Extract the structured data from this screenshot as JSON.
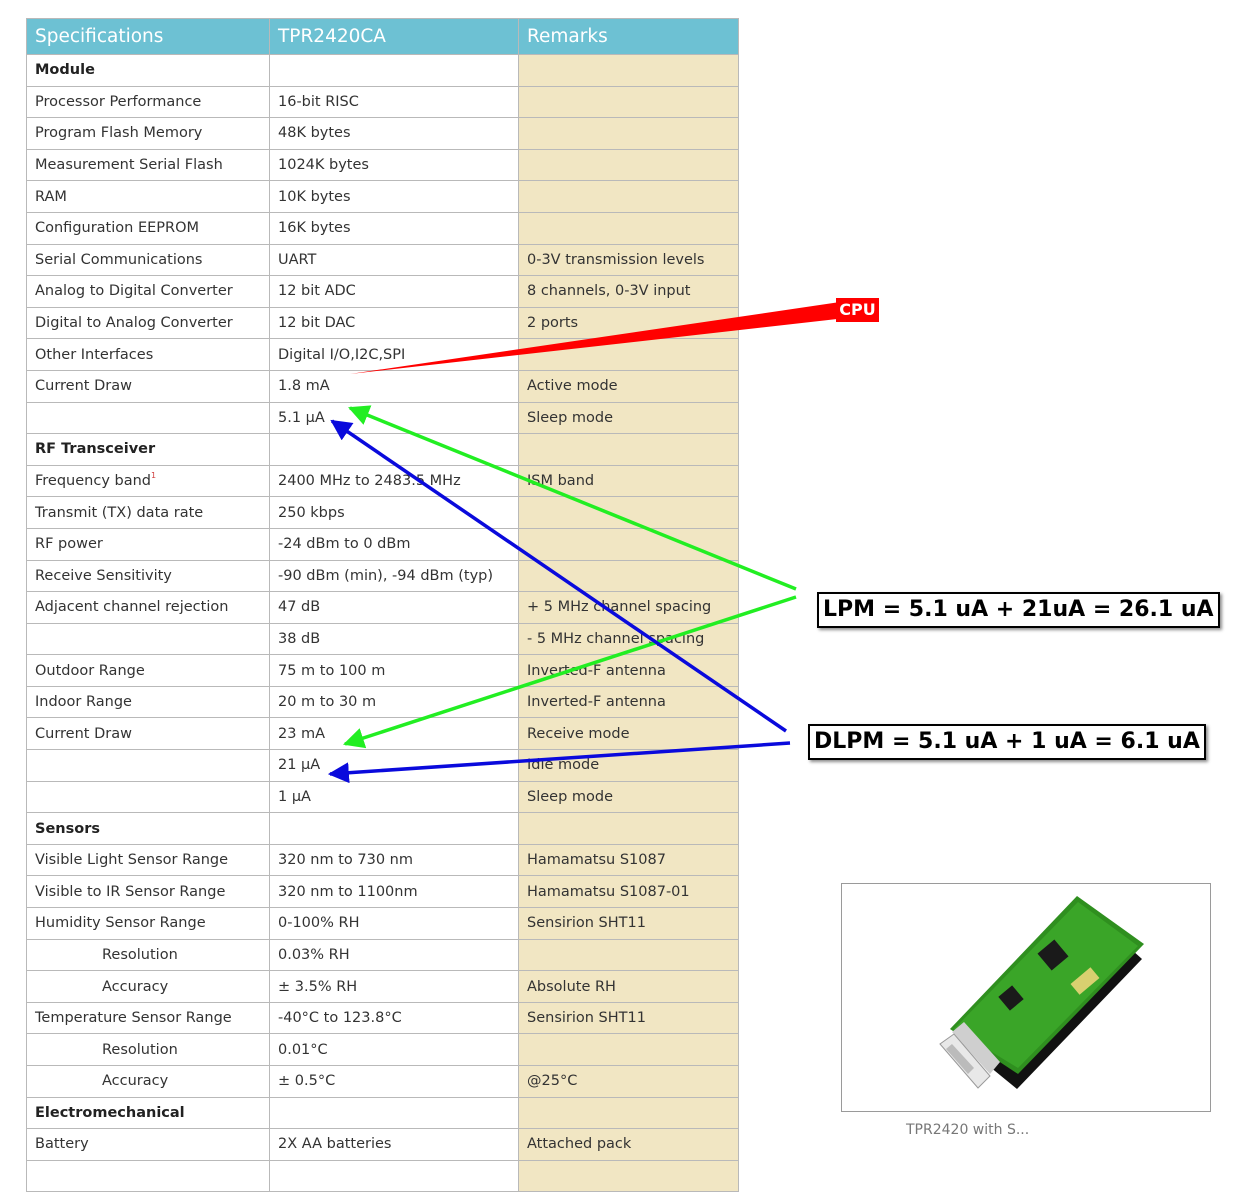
{
  "table": {
    "headers": [
      "Specifications",
      "TPR2420CA",
      "Remarks"
    ],
    "rows": [
      {
        "type": "section",
        "spec": "Module",
        "value": "",
        "remark": ""
      },
      {
        "spec": "Processor Performance",
        "value": "16-bit RISC",
        "remark": ""
      },
      {
        "spec": "Program Flash Memory",
        "value": "48K bytes",
        "remark": ""
      },
      {
        "spec": "Measurement Serial Flash",
        "value": "1024K bytes",
        "remark": ""
      },
      {
        "spec": "RAM",
        "value": "10K bytes",
        "remark": ""
      },
      {
        "spec": "Configuration EEPROM",
        "value": "16K bytes",
        "remark": ""
      },
      {
        "spec": "Serial Communications",
        "value": "UART",
        "remark": "0-3V transmission levels"
      },
      {
        "spec": "Analog to Digital Converter",
        "value": "12 bit ADC",
        "remark": "8 channels, 0-3V input"
      },
      {
        "spec": "Digital to Analog Converter",
        "value": "12 bit DAC",
        "remark": "2 ports"
      },
      {
        "spec": "Other Interfaces",
        "value": "Digital I/O,I2C,SPI",
        "remark": ""
      },
      {
        "spec": "Current Draw",
        "value": "1.8 mA",
        "remark": "Active mode"
      },
      {
        "spec": "",
        "value": "5.1 µA",
        "remark": "Sleep mode"
      },
      {
        "type": "section",
        "spec": "RF Transceiver",
        "value": "",
        "remark": ""
      },
      {
        "spec": "Frequency band",
        "footnote": "1",
        "value": "2400 MHz to 2483.5 MHz",
        "remark": " ISM band"
      },
      {
        "spec": "Transmit (TX) data rate",
        "value": "250 kbps",
        "remark": ""
      },
      {
        "spec": "RF power",
        "value": "-24 dBm to 0 dBm",
        "remark": ""
      },
      {
        "spec": "Receive Sensitivity",
        "value": "-90 dBm (min), -94 dBm (typ)",
        "remark": ""
      },
      {
        "spec": "Adjacent channel rejection",
        "value": "47 dB",
        "remark": "+ 5 MHz channel spacing"
      },
      {
        "spec": "",
        "value": "38 dB",
        "remark": "- 5 MHz channel spacing"
      },
      {
        "spec": "Outdoor Range",
        "value": "75 m to 100 m",
        "remark": "Inverted-F antenna"
      },
      {
        "spec": "Indoor Range",
        "value": "20 m to 30 m",
        "remark": "Inverted-F antenna"
      },
      {
        "spec": "Current Draw",
        "value": "23 mA",
        "remark": "Receive mode"
      },
      {
        "spec": "",
        "value": "21 µA",
        "remark": "Idle mode"
      },
      {
        "spec": "",
        "value": "1 µA",
        "remark": "Sleep mode"
      },
      {
        "type": "section",
        "spec": "Sensors",
        "value": "",
        "remark": ""
      },
      {
        "spec": "Visible Light Sensor Range",
        "value": "320 nm to 730 nm",
        "remark": "Hamamatsu S1087"
      },
      {
        "spec": "Visible to IR Sensor Range",
        "value": "320 nm to 1100nm",
        "remark": "Hamamatsu S1087-01"
      },
      {
        "spec": "Humidity Sensor Range",
        "value": "0-100% RH",
        "remark": "Sensirion SHT11"
      },
      {
        "type": "indent",
        "spec": "Resolution",
        "value": "0.03% RH",
        "remark": ""
      },
      {
        "type": "indent",
        "spec": "Accuracy",
        "value": "± 3.5% RH",
        "remark": "Absolute RH"
      },
      {
        "spec": "Temperature Sensor Range",
        "value": "-40°C to 123.8°C",
        "remark": "Sensirion SHT11"
      },
      {
        "type": "indent",
        "spec": "Resolution",
        "value": "0.01°C",
        "remark": ""
      },
      {
        "type": "indent",
        "spec": "Accuracy",
        "value": "± 0.5°C",
        "remark": "@25°C"
      },
      {
        "type": "section",
        "spec": "Electromechanical",
        "value": "",
        "remark": ""
      },
      {
        "spec": "Battery",
        "value": "2X AA batteries",
        "remark": "Attached pack"
      },
      {
        "spec": "",
        "value": "",
        "remark": ""
      }
    ]
  },
  "annotations": {
    "cpu_label": "CPU",
    "lpm_text": "LPM = 5.1 uA + 21uA = 26.1 uA",
    "dlpm_text": "DLPM = 5.1 uA + 1 uA = 6.1 uA",
    "colors": {
      "cpu": "#ff0000",
      "lpm": "#22ee22",
      "dlpm": "#0a0adc"
    }
  },
  "photo": {
    "caption": "TPR2420 with S..."
  }
}
